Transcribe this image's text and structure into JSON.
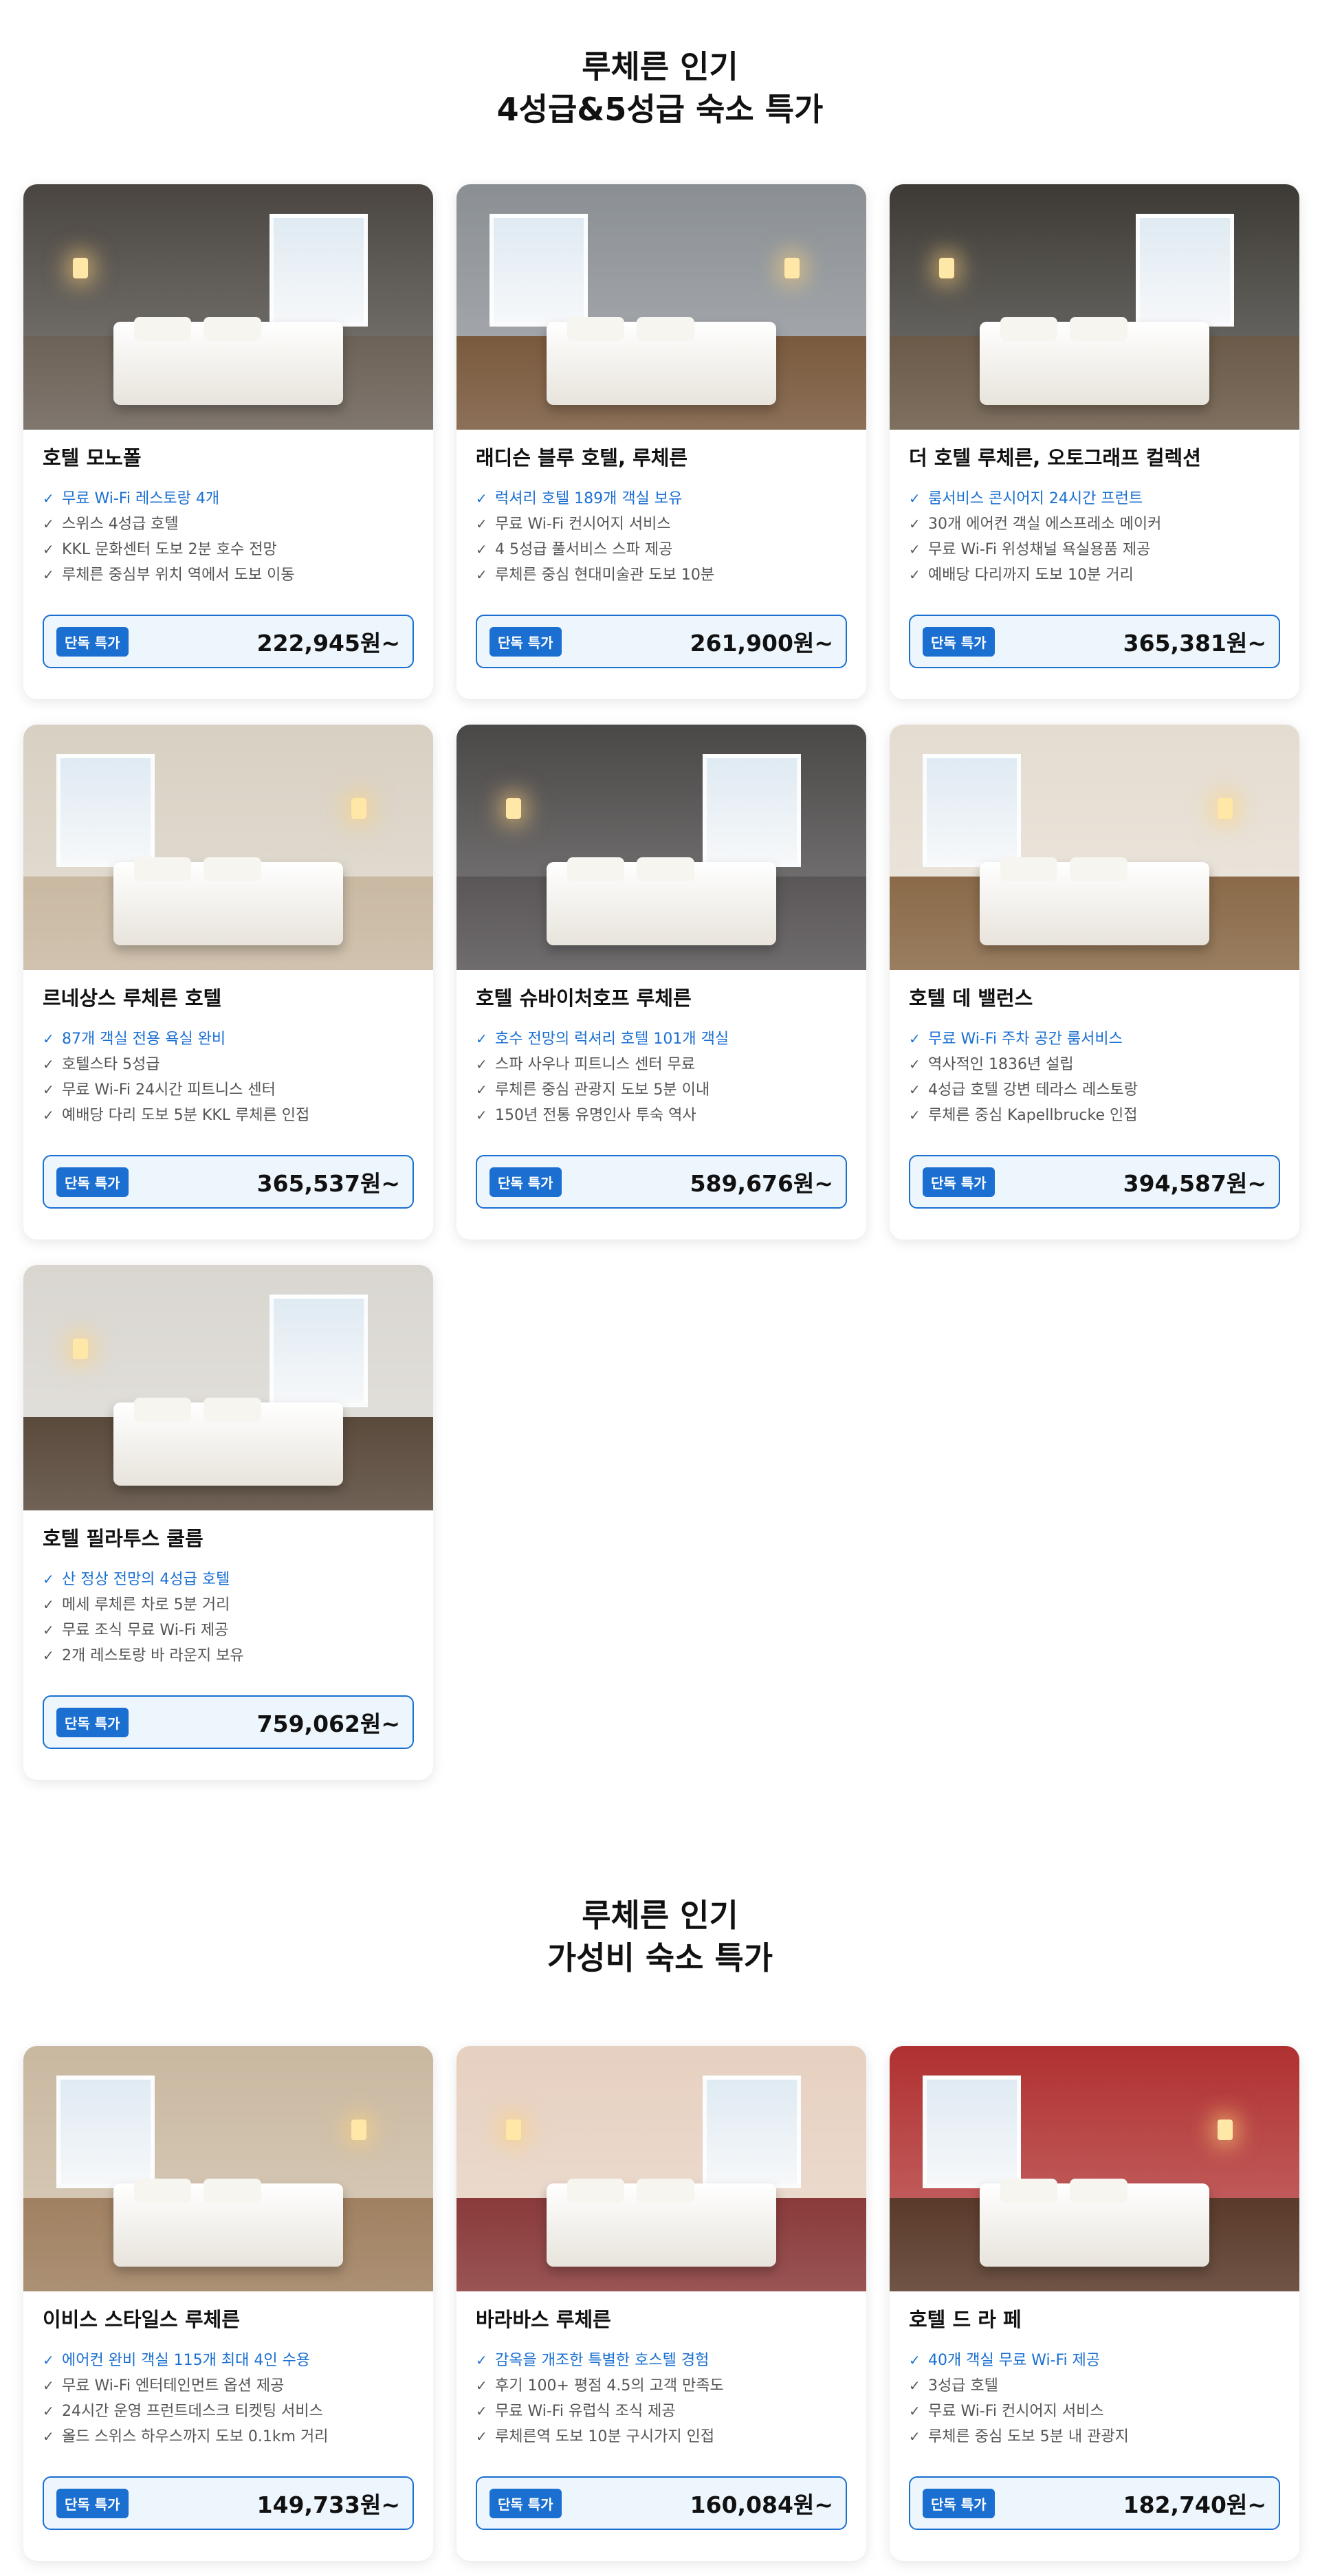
{
  "sections": [
    {
      "title_line1": "루체른 인기",
      "title_line2": "4성급&5성급 숙소 특가",
      "hotels": [
        {
          "name": "호텔 모노폴",
          "features": [
            "무료 Wi-Fi 레스토랑 4개",
            "스위스 4성급 호텔",
            "KKL 문화센터 도보 2분 호수 전망",
            "루체른 중심부 위치 역에서 도보 이동"
          ],
          "badge": "단독 특가",
          "price": "222,945원~"
        },
        {
          "name": "래디슨 블루 호텔, 루체른",
          "features": [
            "럭셔리 호텔 189개 객실 보유",
            "무료 Wi-Fi 컨시어지 서비스",
            "4 5성급 풀서비스 스파 제공",
            "루체른 중심 현대미술관 도보 10분"
          ],
          "badge": "단독 특가",
          "price": "261,900원~"
        },
        {
          "name": "더 호텔 루체른, 오토그래프 컬렉션",
          "features": [
            "룸서비스 콘시어지 24시간 프런트",
            "30개 에어컨 객실 에스프레소 메이커",
            "무료 Wi-Fi 위성채널 욕실용품 제공",
            "예배당 다리까지 도보 10분 거리"
          ],
          "badge": "단독 특가",
          "price": "365,381원~"
        },
        {
          "name": "르네상스 루체른 호텔",
          "features": [
            "87개 객실 전용 욕실 완비",
            "호텔스타 5성급",
            "무료 Wi-Fi 24시간 피트니스 센터",
            "예배당 다리 도보 5분 KKL 루체른 인접"
          ],
          "badge": "단독 특가",
          "price": "365,537원~"
        },
        {
          "name": "호텔 슈바이처호프 루체른",
          "features": [
            "호수 전망의 럭셔리 호텔 101개 객실",
            "스파 사우나 피트니스 센터 무료",
            "루체른 중심 관광지 도보 5분 이내",
            "150년 전통 유명인사 투숙 역사"
          ],
          "badge": "단독 특가",
          "price": "589,676원~"
        },
        {
          "name": "호텔 데 밸런스",
          "features": [
            "무료 Wi-Fi 주차 공간 룸서비스",
            "역사적인 1836년 설립",
            "4성급 호텔 강변 테라스 레스토랑",
            "루체른 중심 Kapellbrucke 인접"
          ],
          "badge": "단독 특가",
          "price": "394,587원~"
        },
        {
          "name": "호텔 필라투스 쿨름",
          "features": [
            "산 정상 전망의 4성급 호텔",
            "메세 루체른 차로 5분 거리",
            "무료 조식 무료 Wi-Fi 제공",
            "2개 레스토랑 바 라운지 보유"
          ],
          "badge": "단독 특가",
          "price": "759,062원~"
        }
      ]
    },
    {
      "title_line1": "루체른 인기",
      "title_line2": "가성비 숙소 특가",
      "hotels": [
        {
          "name": "이비스 스타일스 루체른",
          "features": [
            "에어컨 완비 객실 115개 최대 4인 수용",
            "무료 Wi-Fi 엔터테인먼트 옵션 제공",
            "24시간 운영 프런트데스크 티켓팅 서비스",
            "올드 스위스 하우스까지 도보 0.1km 거리"
          ],
          "badge": "단독 특가",
          "price": "149,733원~"
        },
        {
          "name": "바라바스 루체른",
          "features": [
            "감옥을 개조한 특별한 호스텔 경험",
            "후기 100+ 평점 4.5의 고객 만족도",
            "무료 Wi-Fi 유럽식 조식 제공",
            "루체른역 도보 10분 구시가지 인접"
          ],
          "badge": "단독 특가",
          "price": "160,084원~"
        },
        {
          "name": "호텔 드 라 페",
          "features": [
            "40개 객실 무료 Wi-Fi 제공",
            "3성급 호텔",
            "무료 Wi-Fi 컨시어지 서비스",
            "루체른 중심 도보 5분 내 관광지"
          ],
          "badge": "단독 특가",
          "price": "182,740원~"
        }
      ]
    }
  ],
  "photo_palettes": [
    [
      "#4a4540",
      "#6c6258"
    ],
    [
      "#8a8f94",
      "#7a5a3e"
    ],
    [
      "#3d3a35",
      "#6b5a48"
    ],
    [
      "#d8d0c2",
      "#c9b9a2"
    ],
    [
      "#4a4747",
      "#5a5658"
    ],
    [
      "#e4dcd0",
      "#8a6a48"
    ],
    [
      "#d9d6d0",
      "#5a4a3c"
    ],
    [
      "#c9b8a0",
      "#a08060"
    ],
    [
      "#e6d0c0",
      "#8a3a3a"
    ],
    [
      "#b03030",
      "#5a3a2a"
    ]
  ]
}
